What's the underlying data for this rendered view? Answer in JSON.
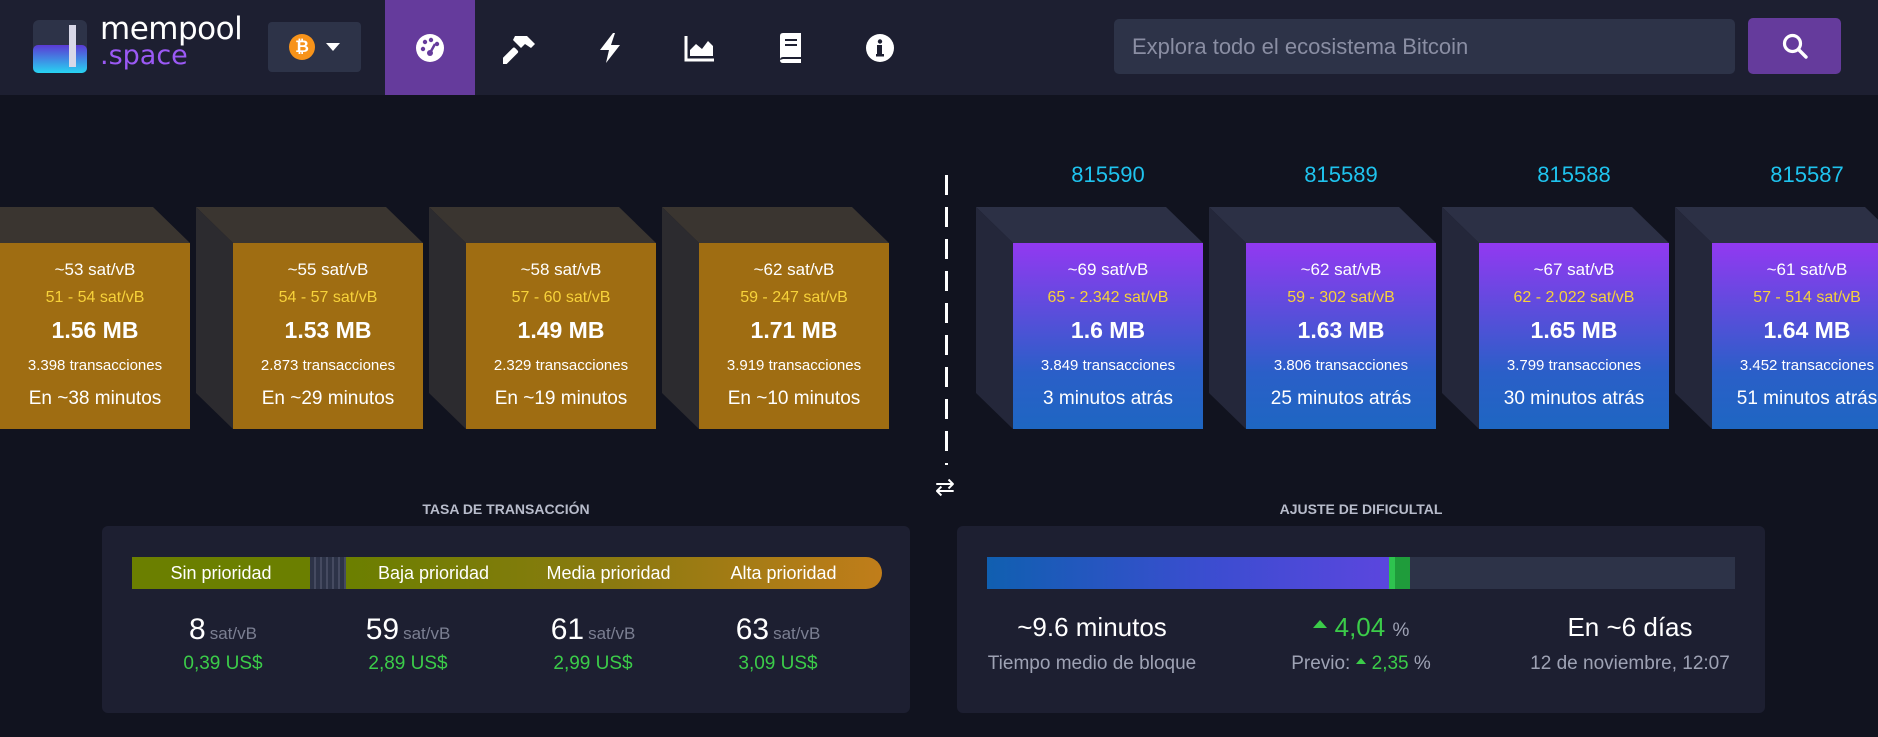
{
  "header": {
    "logo_text": "mempool",
    "logo_suffix": ".space",
    "network_symbol": "₿",
    "search_placeholder": "Explora todo el ecosistema Bitcoin",
    "nav_icons": [
      "dashboard-icon",
      "hammer-icon",
      "lightning-icon",
      "graphs-icon",
      "docs-icon",
      "about-icon"
    ]
  },
  "mempool_blocks": [
    {
      "fee": "~53 sat/vB",
      "range": "51 - 54 sat/vB",
      "size": "1.56 MB",
      "tx": "3.398 transacciones",
      "eta": "En ~38 minutos"
    },
    {
      "fee": "~55 sat/vB",
      "range": "54 - 57 sat/vB",
      "size": "1.53 MB",
      "tx": "2.873 transacciones",
      "eta": "En ~29 minutos"
    },
    {
      "fee": "~58 sat/vB",
      "range": "57 - 60 sat/vB",
      "size": "1.49 MB",
      "tx": "2.329 transacciones",
      "eta": "En ~19 minutos"
    },
    {
      "fee": "~62 sat/vB",
      "range": "59 - 247 sat/vB",
      "size": "1.71 MB",
      "tx": "3.919 transacciones",
      "eta": "En ~10 minutos"
    }
  ],
  "mined_blocks": [
    {
      "height": "815590",
      "fee": "~69 sat/vB",
      "range": "65 - 2.342 sat/vB",
      "size": "1.6 MB",
      "tx": "3.849 transacciones",
      "ago": "3 minutos atrás"
    },
    {
      "height": "815589",
      "fee": "~62 sat/vB",
      "range": "59 - 302 sat/vB",
      "size": "1.63 MB",
      "tx": "3.806 transacciones",
      "ago": "25 minutos atrás"
    },
    {
      "height": "815588",
      "fee": "~67 sat/vB",
      "range": "62 - 2.022 sat/vB",
      "size": "1.65 MB",
      "tx": "3.799 transacciones",
      "ago": "30 minutos atrás"
    },
    {
      "height": "815587",
      "fee": "~61 sat/vB",
      "range": "57 - 514 sat/vB",
      "size": "1.64 MB",
      "tx": "3.452 transacciones",
      "ago": "51 minutos atrás"
    }
  ],
  "fees": {
    "title": "TASA DE TRANSACCIÓN",
    "bar_labels": [
      "Sin prioridad",
      "Baja prioridad",
      "Media prioridad",
      "Alta prioridad"
    ],
    "unit": "sat/vB",
    "items": [
      {
        "value": "8",
        "usd": "0,39 US$"
      },
      {
        "value": "59",
        "usd": "2,89 US$"
      },
      {
        "value": "61",
        "usd": "2,99 US$"
      },
      {
        "value": "63",
        "usd": "3,09 US$"
      }
    ]
  },
  "difficulty": {
    "title": "AJUSTE DE DIFICULTAL",
    "progress_fraction": 0.56,
    "avg_time": "~9.6 minutos",
    "avg_time_label": "Tiempo medio de bloque",
    "change": "4,04",
    "change_unit": "%",
    "prev_label": "Previo:",
    "prev_value": "2,35",
    "prev_unit": "%",
    "eta": "En ~6 días",
    "eta_date": "12 de noviembre, 12:07",
    "colors": {
      "bar": "#3b4dd0",
      "green": "#1f9c3b",
      "bg": "#2d3348"
    }
  }
}
